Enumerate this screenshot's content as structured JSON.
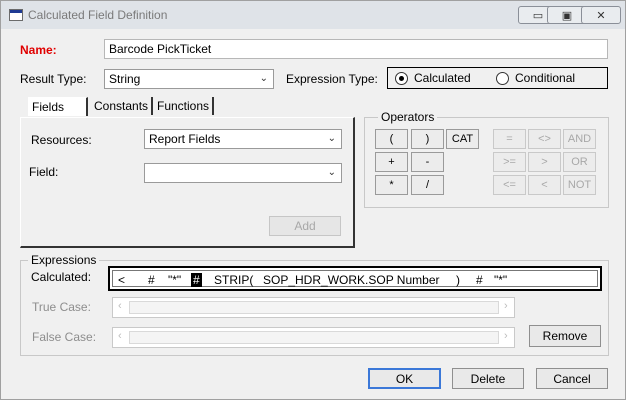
{
  "window": {
    "title": "Calculated Field Definition",
    "controls": {
      "minimize": "▭",
      "maximize": "▣",
      "close": "✕"
    }
  },
  "name": {
    "label": "Name:",
    "value": "Barcode PickTicket"
  },
  "result_type": {
    "label": "Result Type:",
    "value": "String"
  },
  "expression_type": {
    "label": "Expression Type:",
    "options": [
      {
        "label": "Calculated",
        "selected": true
      },
      {
        "label": "Conditional",
        "selected": false
      }
    ]
  },
  "tabs": [
    "Fields",
    "Constants",
    "Functions"
  ],
  "resources": {
    "label": "Resources:",
    "value": "Report Fields"
  },
  "field": {
    "label": "Field:",
    "value": ""
  },
  "add_button": "Add",
  "operators": {
    "title": "Operators",
    "rows": [
      [
        "(",
        ")",
        "CAT",
        "=",
        "<>",
        "AND"
      ],
      [
        "+",
        "-",
        "",
        ">=",
        ">",
        "OR"
      ],
      [
        "*",
        "/",
        "",
        "<=",
        "<",
        "NOT"
      ]
    ]
  },
  "expressions": {
    "title": "Expressions",
    "calculated_label": "Calculated:",
    "tokens": [
      "<",
      "#",
      "\"*\"",
      "#",
      "STRIP(",
      "SOP_HDR_WORK.SOP Number",
      ")",
      "#",
      "\"*\""
    ],
    "true_case_label": "True Case:",
    "false_case_label": "False Case:",
    "remove_button": "Remove"
  },
  "footer": {
    "ok": "OK",
    "delete": "Delete",
    "cancel": "Cancel"
  },
  "icons": {
    "dropdown": "chevron-down-icon",
    "scroll_left": "‹",
    "scroll_right": "›"
  }
}
